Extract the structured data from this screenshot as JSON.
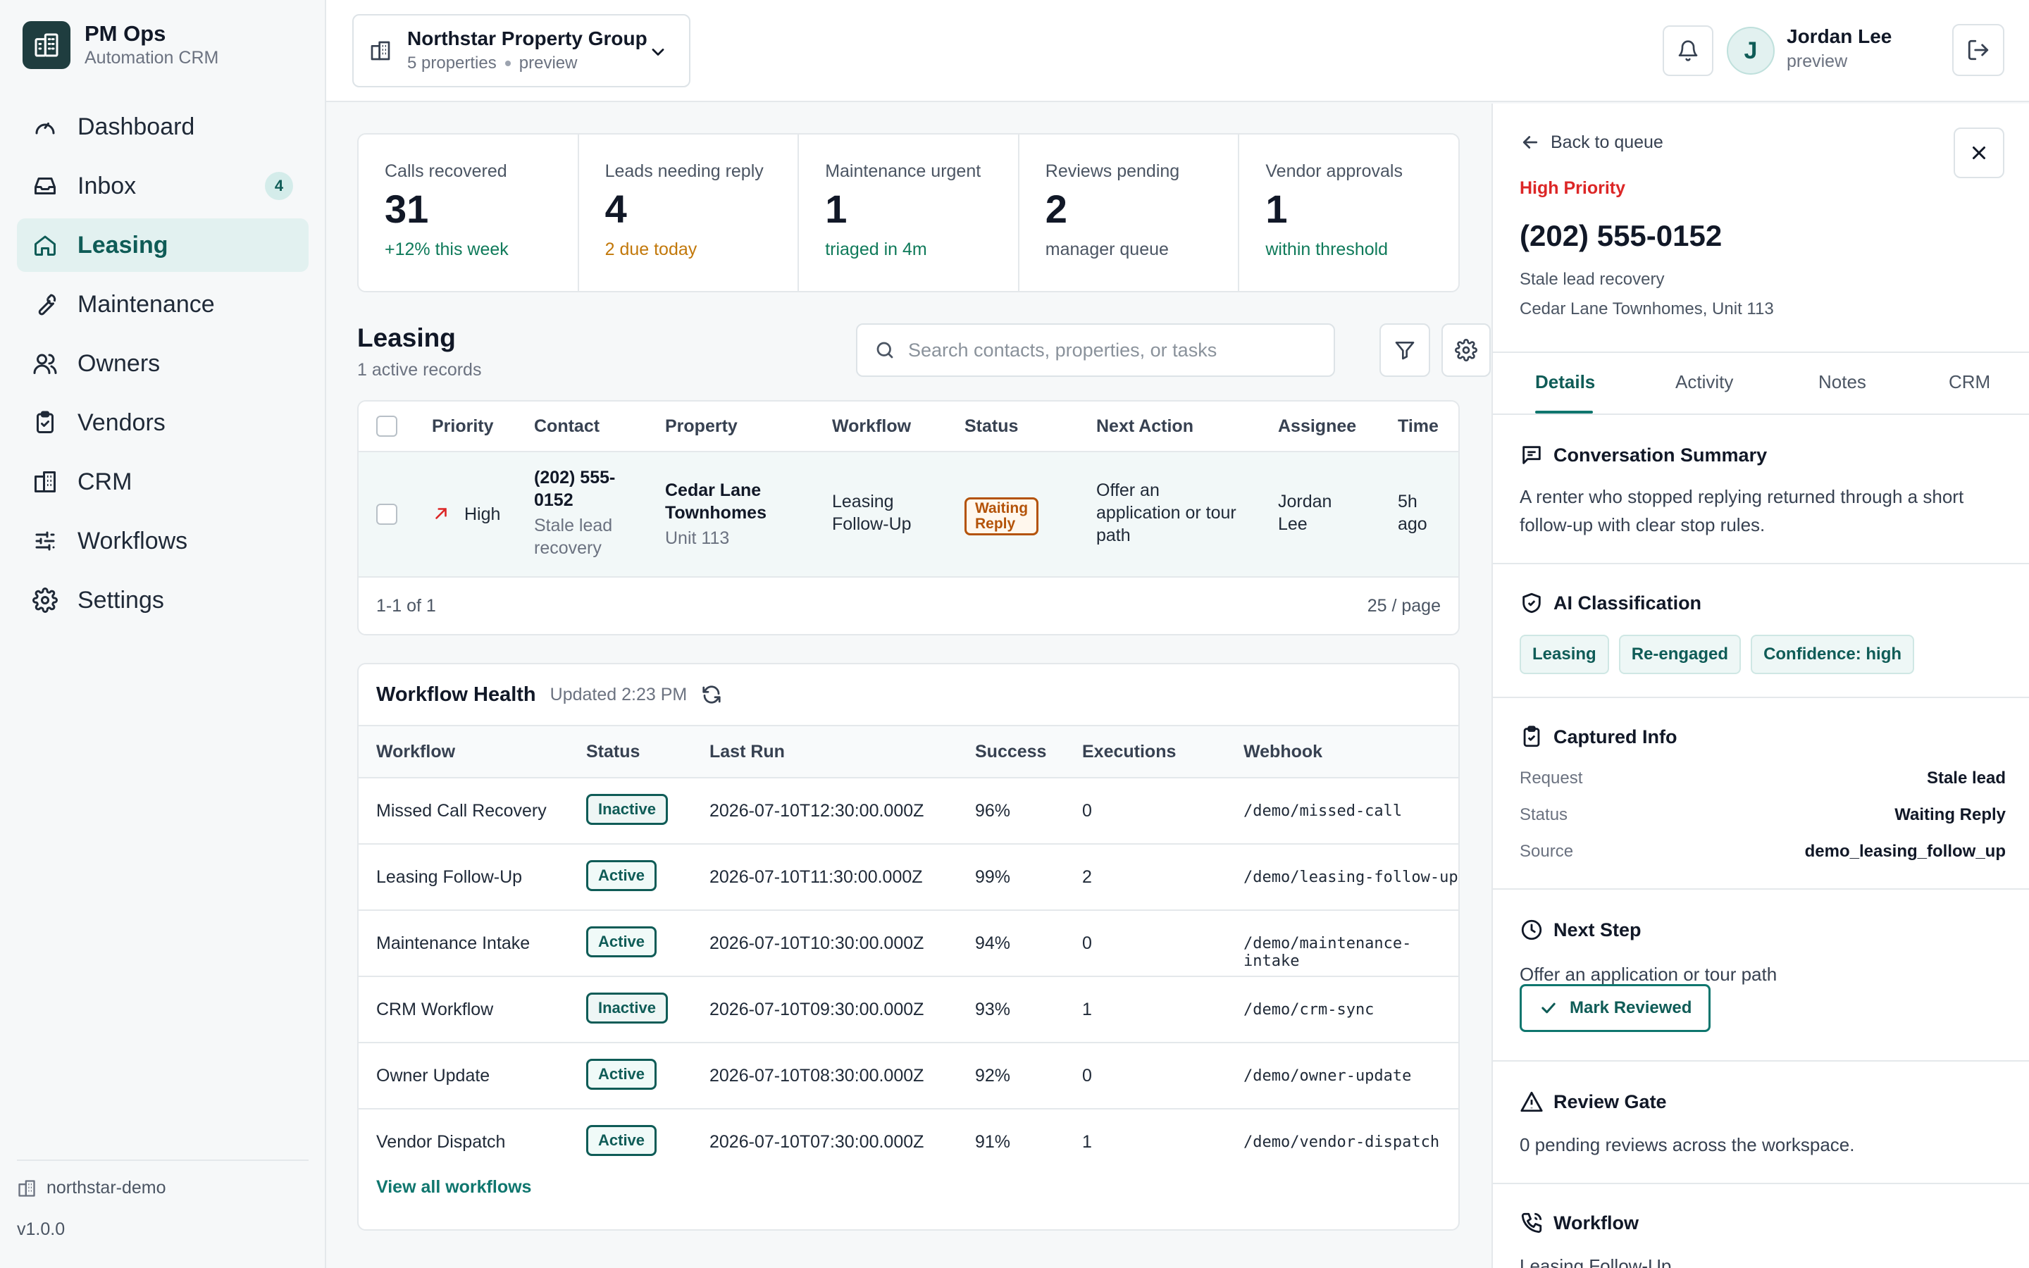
{
  "brand": {
    "name": "PM Ops",
    "subtitle": "Automation CRM"
  },
  "nav": {
    "items": [
      {
        "label": "Dashboard",
        "icon": "gauge-icon"
      },
      {
        "label": "Inbox",
        "icon": "inbox-icon",
        "badge": "4"
      },
      {
        "label": "Leasing",
        "icon": "home-icon",
        "active": true
      },
      {
        "label": "Maintenance",
        "icon": "wrench-icon"
      },
      {
        "label": "Owners",
        "icon": "users-icon"
      },
      {
        "label": "Vendors",
        "icon": "clipboard-check-icon"
      },
      {
        "label": "CRM",
        "icon": "building-icon"
      },
      {
        "label": "Workflows",
        "icon": "sliders-icon"
      },
      {
        "label": "Settings",
        "icon": "gear-icon"
      }
    ]
  },
  "sidebar_footer": {
    "tenant": "northstar-demo",
    "version": "v1.0.0"
  },
  "org": {
    "name": "Northstar Property Group",
    "properties": "5 properties",
    "mode": "preview"
  },
  "user": {
    "initial": "J",
    "name": "Jordan Lee",
    "role": "preview"
  },
  "kpis": [
    {
      "label": "Calls recovered",
      "value": "31",
      "sub": "+12% this week",
      "tone": "green"
    },
    {
      "label": "Leads needing reply",
      "value": "4",
      "sub": "2 due today",
      "tone": "amber"
    },
    {
      "label": "Maintenance urgent",
      "value": "1",
      "sub": "triaged in 4m",
      "tone": "green"
    },
    {
      "label": "Reviews pending",
      "value": "2",
      "sub": "manager queue",
      "tone": "gray"
    },
    {
      "label": "Vendor approvals",
      "value": "1",
      "sub": "within threshold",
      "tone": "green"
    }
  ],
  "leasing": {
    "title": "Leasing",
    "count": "1 active records",
    "search_placeholder": "Search contacts, properties, or tasks",
    "columns": [
      "Priority",
      "Contact",
      "Property",
      "Workflow",
      "Status",
      "Next Action",
      "Assignee",
      "Time"
    ],
    "row": {
      "priority": "High",
      "contact_line1": "(202) 555-",
      "contact_line2": "0152",
      "contact_sub1": "Stale lead",
      "contact_sub2": "recovery",
      "property_line1": "Cedar Lane",
      "property_line2": "Townhomes",
      "property_unit": "Unit 113",
      "workflow_line1": "Leasing",
      "workflow_line2": "Follow-Up",
      "status_line1": "Waiting",
      "status_line2": "Reply",
      "next_line1": "Offer an",
      "next_line2": "application or tour",
      "next_line3": "path",
      "assignee_line1": "Jordan",
      "assignee_line2": "Lee",
      "time_line1": "5h",
      "time_line2": "ago"
    },
    "pagination": "1-1 of 1",
    "page_size": "25 / page"
  },
  "workflow_health": {
    "title": "Workflow Health",
    "updated": "Updated 2:23 PM",
    "columns": [
      "Workflow",
      "Status",
      "Last Run",
      "Success",
      "Executions",
      "Webhook"
    ],
    "rows": [
      {
        "workflow": "Missed Call Recovery",
        "status": "Inactive",
        "last_run": "2026-07-10T12:30:00.000Z",
        "success": "96%",
        "executions": "0",
        "webhook": "/demo/missed-call"
      },
      {
        "workflow": "Leasing Follow-Up",
        "status": "Active",
        "last_run": "2026-07-10T11:30:00.000Z",
        "success": "99%",
        "executions": "2",
        "webhook": "/demo/leasing-follow-up"
      },
      {
        "workflow": "Maintenance Intake",
        "status": "Active",
        "last_run": "2026-07-10T10:30:00.000Z",
        "success": "94%",
        "executions": "0",
        "webhook": "/demo/maintenance-intake"
      },
      {
        "workflow": "CRM Workflow",
        "status": "Inactive",
        "last_run": "2026-07-10T09:30:00.000Z",
        "success": "93%",
        "executions": "1",
        "webhook": "/demo/crm-sync"
      },
      {
        "workflow": "Owner Update",
        "status": "Active",
        "last_run": "2026-07-10T08:30:00.000Z",
        "success": "92%",
        "executions": "0",
        "webhook": "/demo/owner-update"
      },
      {
        "workflow": "Vendor Dispatch",
        "status": "Active",
        "last_run": "2026-07-10T07:30:00.000Z",
        "success": "91%",
        "executions": "1",
        "webhook": "/demo/vendor-dispatch"
      }
    ],
    "view_all": "View all workflows"
  },
  "detail": {
    "back": "Back to queue",
    "priority": "High Priority",
    "phone": "(202) 555-0152",
    "subtitle": "Stale lead recovery",
    "location": "Cedar Lane Townhomes, Unit 113",
    "tabs": [
      "Details",
      "Activity",
      "Notes",
      "CRM"
    ],
    "summary_title": "Conversation Summary",
    "summary_line1": "A renter who stopped replying returned through a short",
    "summary_line2": "follow-up with clear stop rules.",
    "classification_title": "AI Classification",
    "tags": [
      "Leasing",
      "Re-engaged",
      "Confidence: high"
    ],
    "captured_title": "Captured Info",
    "captured": [
      {
        "key": "Request",
        "value": "Stale lead"
      },
      {
        "key": "Status",
        "value": "Waiting Reply"
      },
      {
        "key": "Source",
        "value": "demo_leasing_follow_up"
      }
    ],
    "next_title": "Next Step",
    "next_text": "Offer an application or tour path",
    "mark_reviewed": "Mark Reviewed",
    "review_title": "Review Gate",
    "review_text": "0 pending reviews across the workspace.",
    "workflow_title": "Workflow",
    "workflow_text": "Leasing Follow-Up"
  },
  "colors": {
    "accent": "#0f766e",
    "brand_dark": "#1f3d3f",
    "danger": "#dc2626",
    "warning": "#b45309"
  }
}
